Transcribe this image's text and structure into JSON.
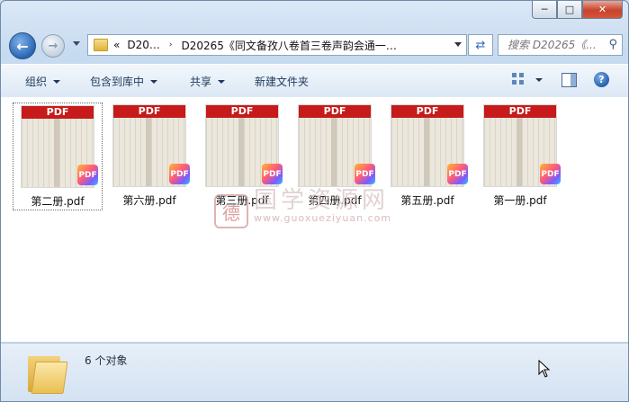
{
  "window": {
    "controls": {
      "minimize_icon": "minimize-icon",
      "maximize_icon": "maximize-icon",
      "close_icon": "close-icon"
    }
  },
  "nav": {
    "back_icon": "back-arrow-icon",
    "forward_icon": "forward-arrow-icon",
    "address": {
      "overflow": "«",
      "crumbs": [
        "D20…",
        "D20265《同文备孜八卷首三卷声韵会通一…"
      ],
      "separator": "›"
    },
    "search": {
      "placeholder": "搜索 D20265《...",
      "icon": "search-icon"
    }
  },
  "toolbar": {
    "organize": "组织",
    "include_library": "包含到库中",
    "share": "共享",
    "new_folder": "新建文件夹",
    "help": "?"
  },
  "files": [
    {
      "name": "第二册.pdf",
      "badge": "PDF",
      "selected": true
    },
    {
      "name": "第六册.pdf",
      "badge": "PDF",
      "selected": false
    },
    {
      "name": "第三册.pdf",
      "badge": "PDF",
      "selected": false
    },
    {
      "name": "第四册.pdf",
      "badge": "PDF",
      "selected": false
    },
    {
      "name": "第五册.pdf",
      "badge": "PDF",
      "selected": false
    },
    {
      "name": "第一册.pdf",
      "badge": "PDF",
      "selected": false
    }
  ],
  "watermark": {
    "seal": "德",
    "cn": "国学资源网",
    "url": "www.guoxueziyuan.com"
  },
  "status": {
    "count": "6 个对象"
  }
}
